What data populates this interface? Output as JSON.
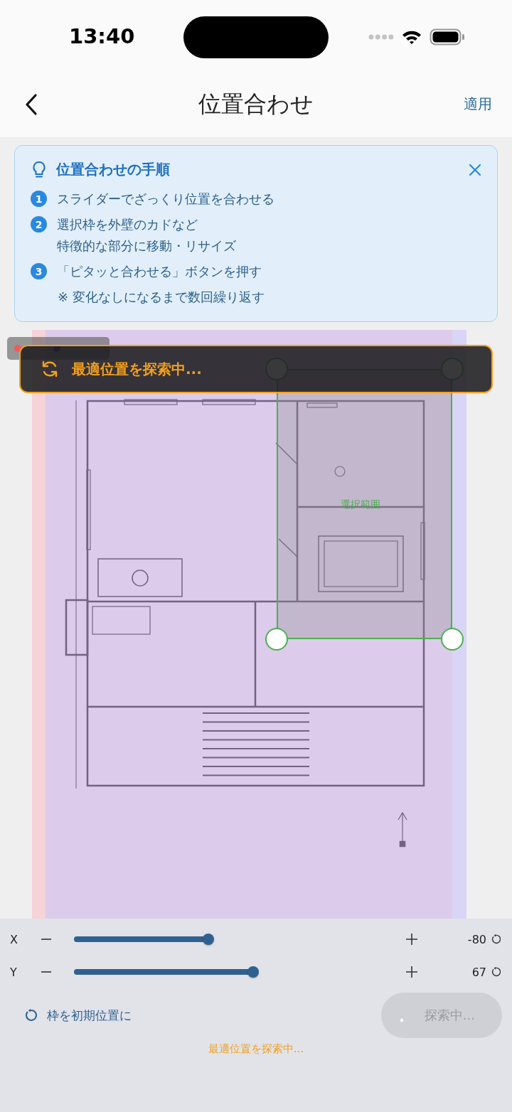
{
  "status_bar": {
    "time": "13:40"
  },
  "nav": {
    "title": "位置合わせ",
    "action": "適用"
  },
  "guide": {
    "title": "位置合わせの手順",
    "steps": [
      {
        "number": "1",
        "lines": [
          "スライダーでざっくり位置を合わせる"
        ]
      },
      {
        "number": "2",
        "lines": [
          "選択枠を外壁のカドなど",
          "特徴的な部分に移動・リサイズ"
        ]
      },
      {
        "number": "3",
        "lines": [
          "「ピタッと合わせる」ボタンを押す"
        ]
      }
    ],
    "note": "※ 変化なしになるまで数回繰り返す"
  },
  "canvas": {
    "banner": {
      "text": "最適位置を探索中..."
    },
    "selection": {
      "label": "選択範囲"
    }
  },
  "sliders": [
    {
      "axis": "X",
      "level": 0.42,
      "reading": "-80"
    },
    {
      "axis": "Y",
      "level": 0.56,
      "reading": "67"
    }
  ],
  "reset_frame": "枠を初期位置に",
  "search_button": {
    "label": "探索中...",
    "disabled": true
  },
  "status_message": "最適位置を探索中..."
}
